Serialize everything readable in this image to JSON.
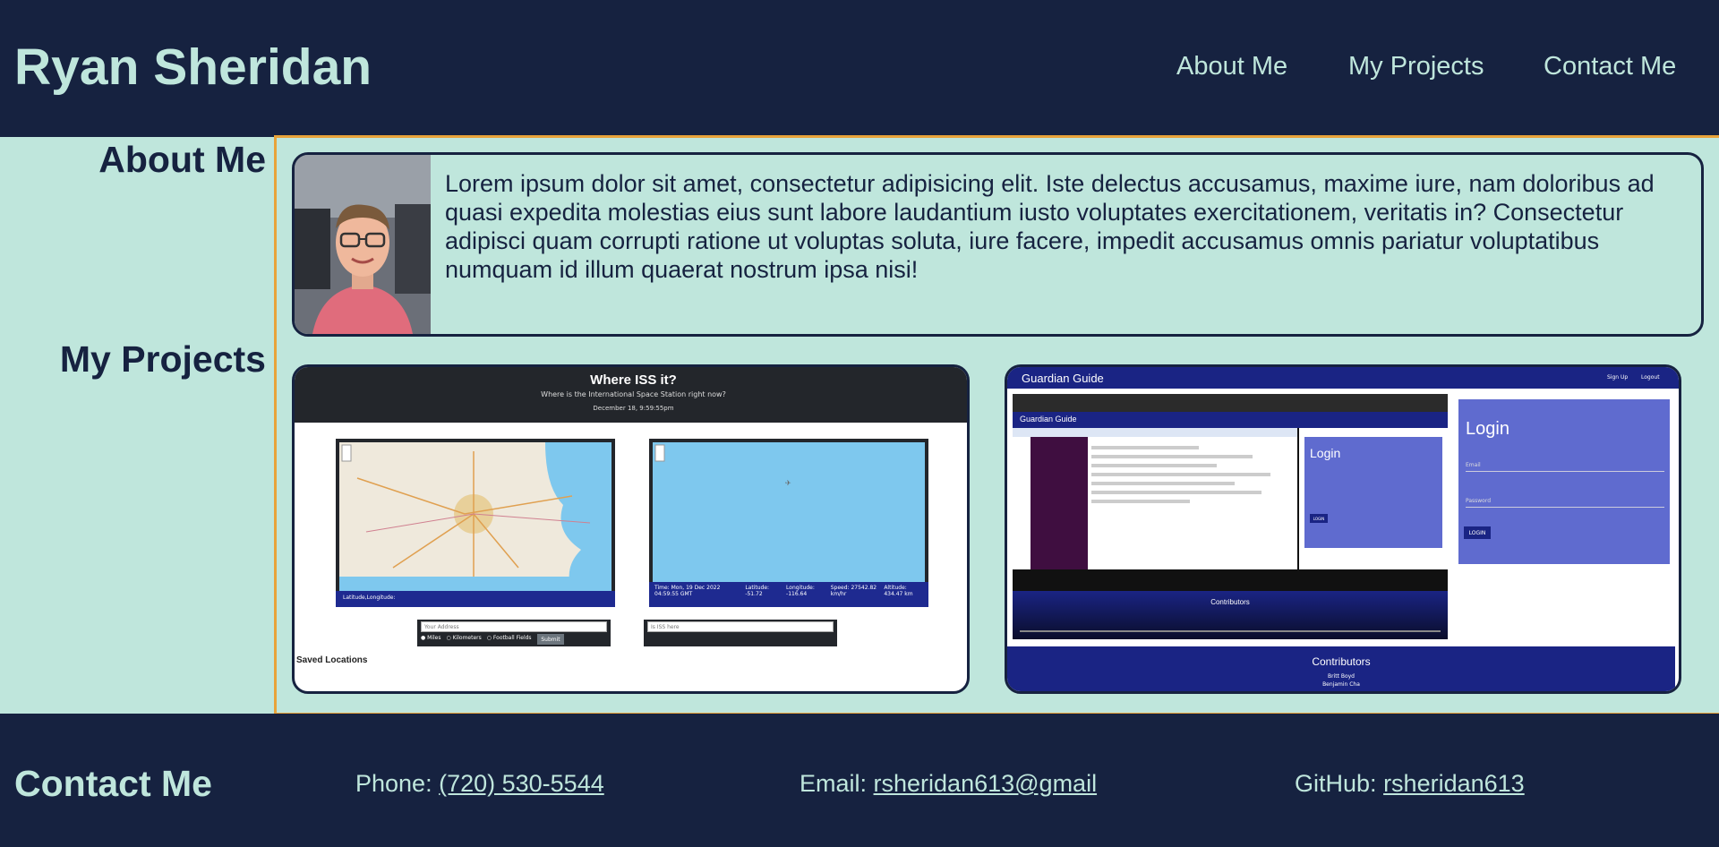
{
  "header": {
    "title": "Ryan Sheridan",
    "nav": [
      "About Me",
      "My Projects",
      "Contact Me"
    ]
  },
  "sections": {
    "about_label": "About Me",
    "projects_label": "My Projects"
  },
  "about": {
    "text": "Lorem ipsum dolor sit amet, consectetur adipisicing elit. Iste delectus accusamus, maxime iure, nam doloribus ad quasi expedita molestias eius sunt labore laudantium iusto voluptates exercitationem, veritatis in? Consectetur adipisci quam corrupti ratione ut voluptas soluta, iure facere, impedit accusamus omnis pariatur voluptatibus numquam id illum quaerat nostrum ipsa nisi!"
  },
  "project_iss": {
    "title": "Where ISS it?",
    "subtitle": "Where is the International Space Station right now?",
    "date": "December 18, 9:59:55pm",
    "map_left_footer": "Latitude,Longitude:",
    "map_right_stats": [
      "Time: Mon, 19 Dec 2022 04:59:55 GMT",
      "Latitude: -51.72",
      "Longitude: -116.64",
      "Speed: 27542.82 km/hr",
      "Altitude: 434.47 km"
    ],
    "address_placeholder": "Your Address",
    "radio_options": [
      "Miles",
      "Kilometers",
      "Football Fields"
    ],
    "submit_label": "Submit",
    "iss_placeholder": "Is ISS here",
    "saved_label": "Saved Locations"
  },
  "project_guardian": {
    "app_name": "Guardian Guide",
    "signup": "Sign Up",
    "logout": "Logout",
    "login_title": "Login",
    "email_label": "Email",
    "password_label": "Password",
    "login_button": "LOGIN",
    "contributors_title": "Contributors",
    "contributors": [
      "Britt Boyd",
      "Benjamin Cha"
    ]
  },
  "footer": {
    "title": "Contact Me",
    "phone_label": "Phone:",
    "phone": "(720) 530-5544",
    "email_label": "Email:",
    "email": "rsheridan613@gmail",
    "github_label": "GitHub:",
    "github": "rsheridan613"
  },
  "colors": {
    "navy": "#162240",
    "mint": "#bfe6dc",
    "orange_border": "#e8a33a",
    "guardian_blue": "#1a2484",
    "guardian_login": "#5f6bcf"
  }
}
